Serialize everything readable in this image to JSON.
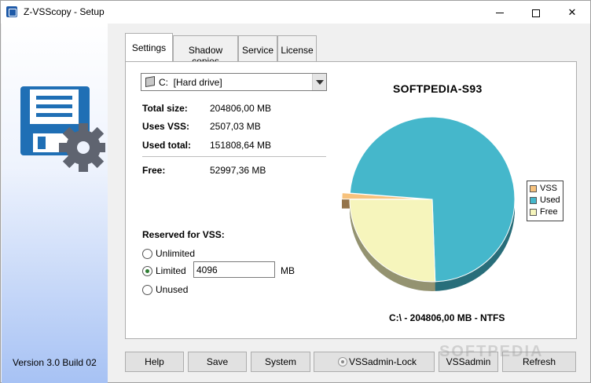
{
  "window": {
    "title": "Z-VSScopy - Setup",
    "minimize_glyph": "",
    "close_glyph": "✕"
  },
  "sidebar": {
    "icon": "floppy-gear-icon",
    "version": "Version 3.0 Build 02"
  },
  "tabs": [
    {
      "label": "Settings",
      "active": true
    },
    {
      "label": "Shadow copies",
      "active": false
    },
    {
      "label": "Service",
      "active": false
    },
    {
      "label": "License",
      "active": false
    }
  ],
  "drive": {
    "letter": "C:",
    "name": "[Hard drive]",
    "icon": "hard-drive-icon"
  },
  "stats": {
    "total_size_label": "Total size:",
    "total_size_value": "204806,00 MB",
    "uses_vss_label": "Uses VSS:",
    "uses_vss_value": "2507,03 MB",
    "used_total_label": "Used total:",
    "used_total_value": "151808,64 MB",
    "free_label": "Free:",
    "free_value": "52997,36 MB"
  },
  "reserved": {
    "title": "Reserved for VSS:",
    "options": [
      "Unlimited",
      "Limited",
      "Unused"
    ],
    "selected": "Limited",
    "limit_value": "4096",
    "unit": "MB"
  },
  "chart_data": {
    "type": "pie",
    "title": "SOFTPEDIA-S93",
    "footer": "C:\\ - 204806,00 MB - NTFS",
    "categories": [
      "VSS",
      "Used",
      "Free"
    ],
    "values": [
      2507.03,
      151808.64,
      52997.36
    ],
    "colors": [
      "#f7c27d",
      "#45b7cb",
      "#f6f5bc"
    ],
    "exploded": "VSS",
    "legend_position": "right"
  },
  "buttons": {
    "help": "Help",
    "save": "Save",
    "system": "System",
    "vssadmin_lock": "VSSadmin-Lock",
    "vssadmin": "VSSadmin",
    "refresh": "Refresh"
  },
  "watermark": "SOFTPEDIA"
}
